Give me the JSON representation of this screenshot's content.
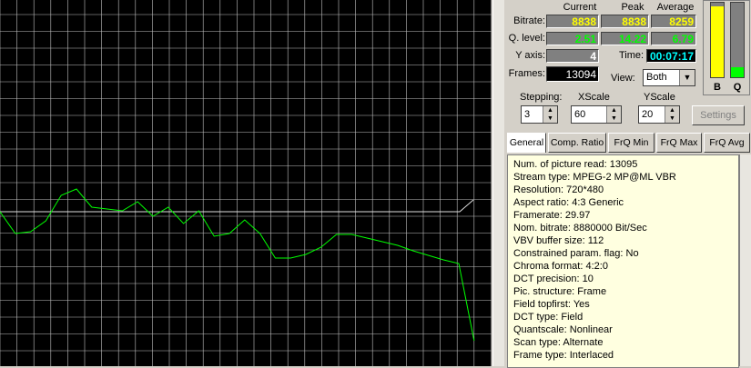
{
  "graph": {
    "grid_color": "#c0c0c0",
    "line_color": "#00ff00",
    "y_series": [
      233,
      257,
      255,
      243,
      215,
      208,
      228,
      230,
      232,
      222,
      238,
      228,
      246,
      232,
      260,
      257,
      242,
      257,
      284,
      284,
      280,
      272,
      258,
      258,
      262,
      266,
      270,
      276,
      281,
      286,
      290,
      375
    ],
    "tail_series": [
      233,
      220
    ]
  },
  "stats": {
    "col_current": "Current",
    "col_peak": "Peak",
    "col_average": "Average",
    "bitrate_label": "Bitrate:",
    "bitrate_current": "8838",
    "bitrate_peak": "8838",
    "bitrate_average": "8259",
    "qlevel_label": "Q. level:",
    "qlevel_current": "2.51",
    "qlevel_peak": "14.22",
    "qlevel_average": "6.79",
    "yaxis_label": "Y axis:",
    "yaxis_value": "4",
    "time_label": "Time:",
    "time_value": "00:07:17",
    "frames_label": "Frames:",
    "frames_value": "13094",
    "view_label": "View:",
    "view_value": "Both"
  },
  "meters": {
    "b_label": "B",
    "q_label": "Q",
    "b_level": 0.95,
    "q_level": 0.14,
    "b_color": "#ffff00",
    "q_color": "#00ff00"
  },
  "controls": {
    "stepping_label": "Stepping:",
    "stepping_value": "3",
    "xscale_label": "XScale",
    "xscale_value": "60",
    "yscale_label": "YScale",
    "yscale_value": "20",
    "settings_label": "Settings"
  },
  "tabs": [
    "General",
    "Comp. Ratio",
    "FrQ Min",
    "FrQ Max",
    "FrQ Avg"
  ],
  "info_lines": [
    "Num. of picture read: 13095",
    "Stream type: MPEG-2  MP@ML  VBR",
    "Resolution: 720*480",
    "Aspect ratio: 4:3 Generic",
    "Framerate: 29.97",
    "Nom. bitrate: 8880000 Bit/Sec",
    "VBV buffer size: 112",
    "Constrained param. flag: No",
    "Chroma format: 4:2:0",
    "DCT precision: 10",
    "Pic. structure: Frame",
    "Field topfirst: Yes",
    "DCT type: Field",
    "Quantscale: Nonlinear",
    "Scan type: Alternate",
    "Frame type: Interlaced"
  ]
}
